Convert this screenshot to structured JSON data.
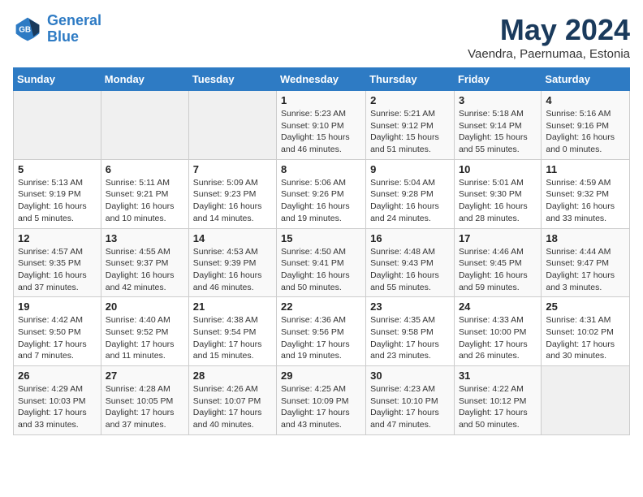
{
  "logo": {
    "line1": "General",
    "line2": "Blue"
  },
  "title": "May 2024",
  "subtitle": "Vaendra, Paernumaa, Estonia",
  "days_of_week": [
    "Sunday",
    "Monday",
    "Tuesday",
    "Wednesday",
    "Thursday",
    "Friday",
    "Saturday"
  ],
  "weeks": [
    [
      {
        "day": "",
        "info": ""
      },
      {
        "day": "",
        "info": ""
      },
      {
        "day": "",
        "info": ""
      },
      {
        "day": "1",
        "info": "Sunrise: 5:23 AM\nSunset: 9:10 PM\nDaylight: 15 hours and 46 minutes."
      },
      {
        "day": "2",
        "info": "Sunrise: 5:21 AM\nSunset: 9:12 PM\nDaylight: 15 hours and 51 minutes."
      },
      {
        "day": "3",
        "info": "Sunrise: 5:18 AM\nSunset: 9:14 PM\nDaylight: 15 hours and 55 minutes."
      },
      {
        "day": "4",
        "info": "Sunrise: 5:16 AM\nSunset: 9:16 PM\nDaylight: 16 hours and 0 minutes."
      }
    ],
    [
      {
        "day": "5",
        "info": "Sunrise: 5:13 AM\nSunset: 9:19 PM\nDaylight: 16 hours and 5 minutes."
      },
      {
        "day": "6",
        "info": "Sunrise: 5:11 AM\nSunset: 9:21 PM\nDaylight: 16 hours and 10 minutes."
      },
      {
        "day": "7",
        "info": "Sunrise: 5:09 AM\nSunset: 9:23 PM\nDaylight: 16 hours and 14 minutes."
      },
      {
        "day": "8",
        "info": "Sunrise: 5:06 AM\nSunset: 9:26 PM\nDaylight: 16 hours and 19 minutes."
      },
      {
        "day": "9",
        "info": "Sunrise: 5:04 AM\nSunset: 9:28 PM\nDaylight: 16 hours and 24 minutes."
      },
      {
        "day": "10",
        "info": "Sunrise: 5:01 AM\nSunset: 9:30 PM\nDaylight: 16 hours and 28 minutes."
      },
      {
        "day": "11",
        "info": "Sunrise: 4:59 AM\nSunset: 9:32 PM\nDaylight: 16 hours and 33 minutes."
      }
    ],
    [
      {
        "day": "12",
        "info": "Sunrise: 4:57 AM\nSunset: 9:35 PM\nDaylight: 16 hours and 37 minutes."
      },
      {
        "day": "13",
        "info": "Sunrise: 4:55 AM\nSunset: 9:37 PM\nDaylight: 16 hours and 42 minutes."
      },
      {
        "day": "14",
        "info": "Sunrise: 4:53 AM\nSunset: 9:39 PM\nDaylight: 16 hours and 46 minutes."
      },
      {
        "day": "15",
        "info": "Sunrise: 4:50 AM\nSunset: 9:41 PM\nDaylight: 16 hours and 50 minutes."
      },
      {
        "day": "16",
        "info": "Sunrise: 4:48 AM\nSunset: 9:43 PM\nDaylight: 16 hours and 55 minutes."
      },
      {
        "day": "17",
        "info": "Sunrise: 4:46 AM\nSunset: 9:45 PM\nDaylight: 16 hours and 59 minutes."
      },
      {
        "day": "18",
        "info": "Sunrise: 4:44 AM\nSunset: 9:47 PM\nDaylight: 17 hours and 3 minutes."
      }
    ],
    [
      {
        "day": "19",
        "info": "Sunrise: 4:42 AM\nSunset: 9:50 PM\nDaylight: 17 hours and 7 minutes."
      },
      {
        "day": "20",
        "info": "Sunrise: 4:40 AM\nSunset: 9:52 PM\nDaylight: 17 hours and 11 minutes."
      },
      {
        "day": "21",
        "info": "Sunrise: 4:38 AM\nSunset: 9:54 PM\nDaylight: 17 hours and 15 minutes."
      },
      {
        "day": "22",
        "info": "Sunrise: 4:36 AM\nSunset: 9:56 PM\nDaylight: 17 hours and 19 minutes."
      },
      {
        "day": "23",
        "info": "Sunrise: 4:35 AM\nSunset: 9:58 PM\nDaylight: 17 hours and 23 minutes."
      },
      {
        "day": "24",
        "info": "Sunrise: 4:33 AM\nSunset: 10:00 PM\nDaylight: 17 hours and 26 minutes."
      },
      {
        "day": "25",
        "info": "Sunrise: 4:31 AM\nSunset: 10:02 PM\nDaylight: 17 hours and 30 minutes."
      }
    ],
    [
      {
        "day": "26",
        "info": "Sunrise: 4:29 AM\nSunset: 10:03 PM\nDaylight: 17 hours and 33 minutes."
      },
      {
        "day": "27",
        "info": "Sunrise: 4:28 AM\nSunset: 10:05 PM\nDaylight: 17 hours and 37 minutes."
      },
      {
        "day": "28",
        "info": "Sunrise: 4:26 AM\nSunset: 10:07 PM\nDaylight: 17 hours and 40 minutes."
      },
      {
        "day": "29",
        "info": "Sunrise: 4:25 AM\nSunset: 10:09 PM\nDaylight: 17 hours and 43 minutes."
      },
      {
        "day": "30",
        "info": "Sunrise: 4:23 AM\nSunset: 10:10 PM\nDaylight: 17 hours and 47 minutes."
      },
      {
        "day": "31",
        "info": "Sunrise: 4:22 AM\nSunset: 10:12 PM\nDaylight: 17 hours and 50 minutes."
      },
      {
        "day": "",
        "info": ""
      }
    ]
  ]
}
